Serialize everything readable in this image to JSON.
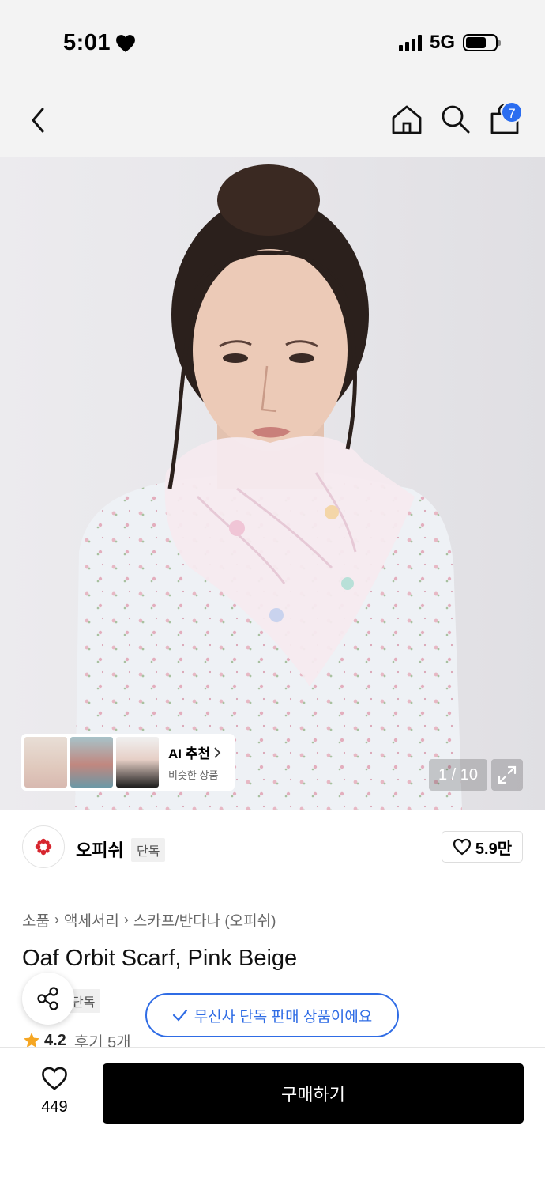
{
  "status_bar": {
    "time": "5:01",
    "network": "5G"
  },
  "nav": {
    "cart_count": "7"
  },
  "hero": {
    "ai_card": {
      "title": "AI 추천",
      "subtitle": "비슷한 상품"
    },
    "image_counter": "1 / 10"
  },
  "brand": {
    "name": "오피쉬",
    "tag": "단독",
    "likes": "5.9만"
  },
  "breadcrumb": [
    "소품",
    "액세서리",
    "스카프/반다나 (오피쉬)"
  ],
  "product": {
    "title": "Oaf Orbit Scarf, Pink Beige",
    "tag": "단독",
    "exclusive_notice": "무신사 단독 판매 상품이에요",
    "rating": "4.2",
    "reviews": "후기 5개"
  },
  "bottom": {
    "wish_count": "449",
    "buy_label": "구매하기"
  },
  "colors": {
    "accent_blue": "#2f6ce5",
    "badge_blue": "#2b6df0",
    "star": "#f5a623",
    "brand_red": "#d7262f"
  }
}
